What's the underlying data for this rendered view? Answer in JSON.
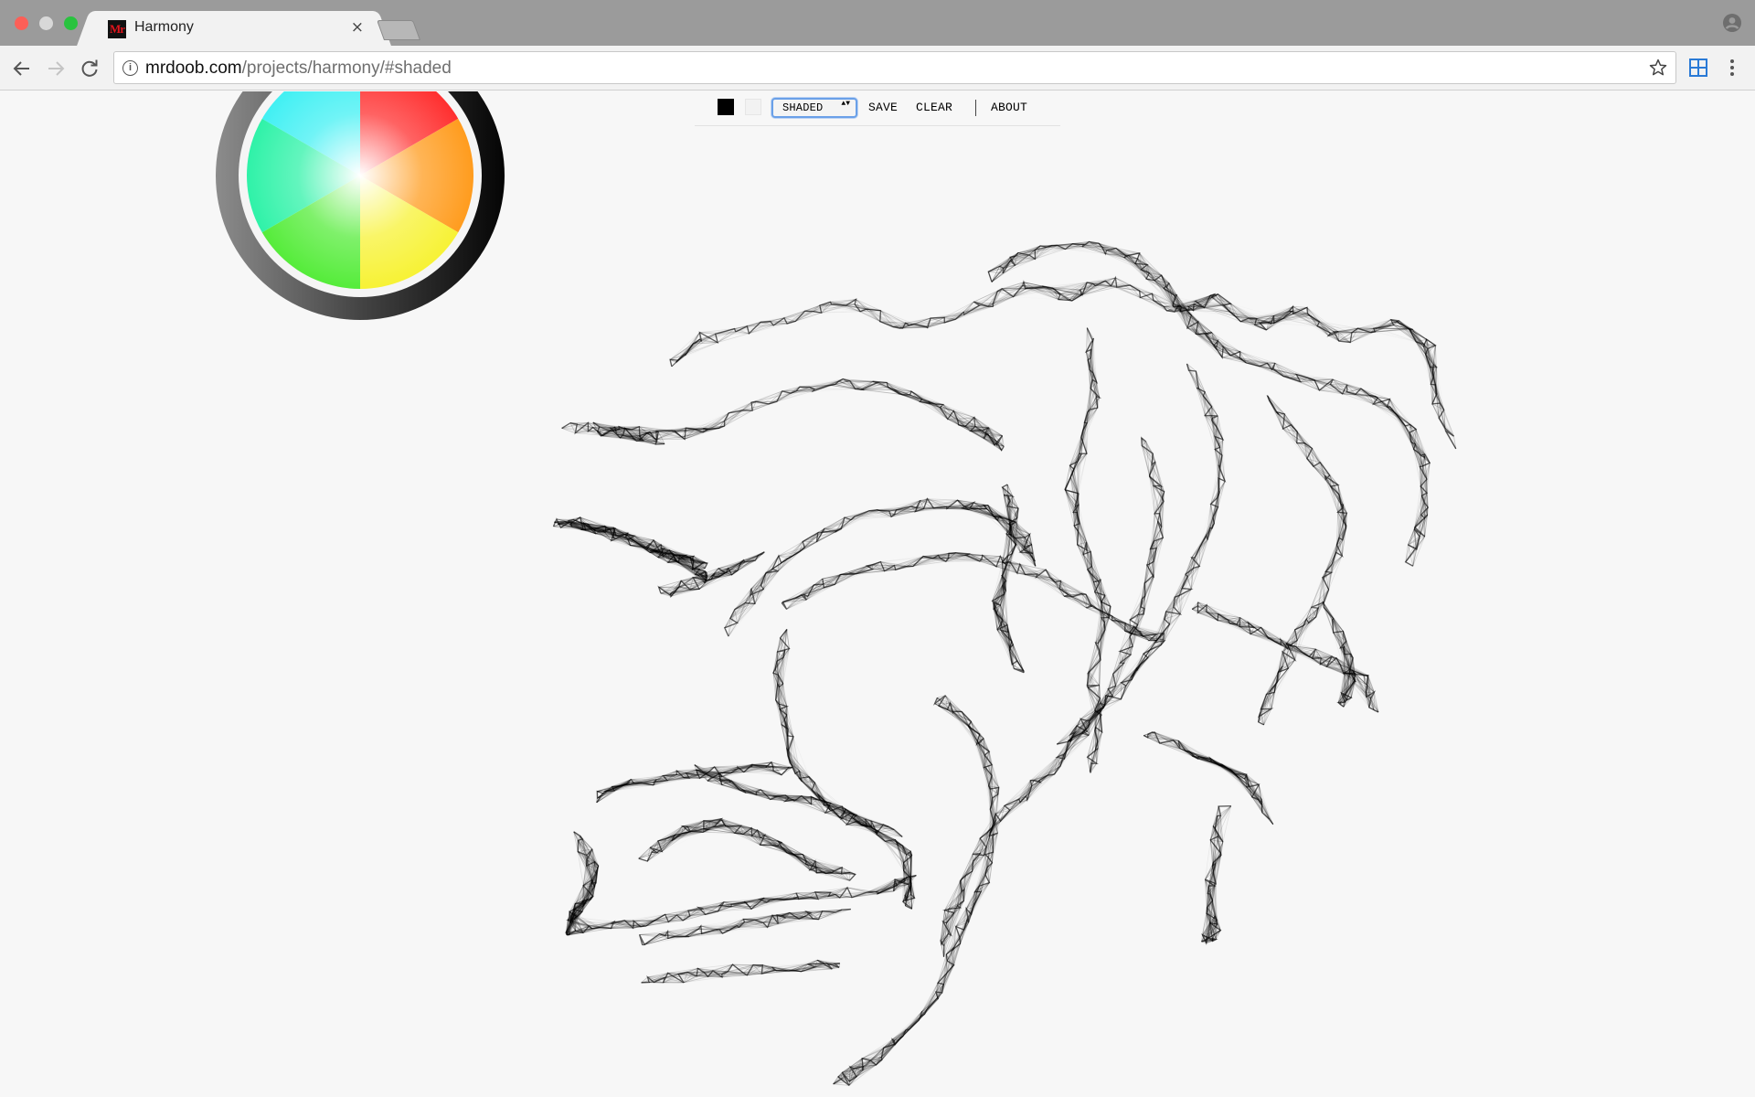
{
  "window": {
    "tab_title": "Harmony",
    "tab_favicon_text": "Mr",
    "tab_close_glyph": "×",
    "close_color": "#fc5f57",
    "minimize_color": "#d8d8d8",
    "maximize_color": "#29c33f"
  },
  "toolbar": {
    "url_host": "mrdoob.com",
    "url_path": "/projects/harmony/#shaded",
    "info_icon_glyph": "i",
    "icons": [
      "back-arrow-icon",
      "forward-arrow-icon",
      "reload-icon",
      "info-icon",
      "star-icon",
      "extension-grid-icon",
      "kebab-menu-icon",
      "profile-icon"
    ]
  },
  "app_menu": {
    "foreground_color": "#000000",
    "background_color": "#f2f2f2",
    "brush_selected": "SHADED",
    "save_label": "SAVE",
    "clear_label": "CLEAR",
    "about_label": "ABOUT",
    "select_arrows": "▲▼"
  },
  "palette": {
    "selected_hue_color": "#000000",
    "stroke_color": "#000000",
    "canvas_background": "#f7f7f7"
  }
}
